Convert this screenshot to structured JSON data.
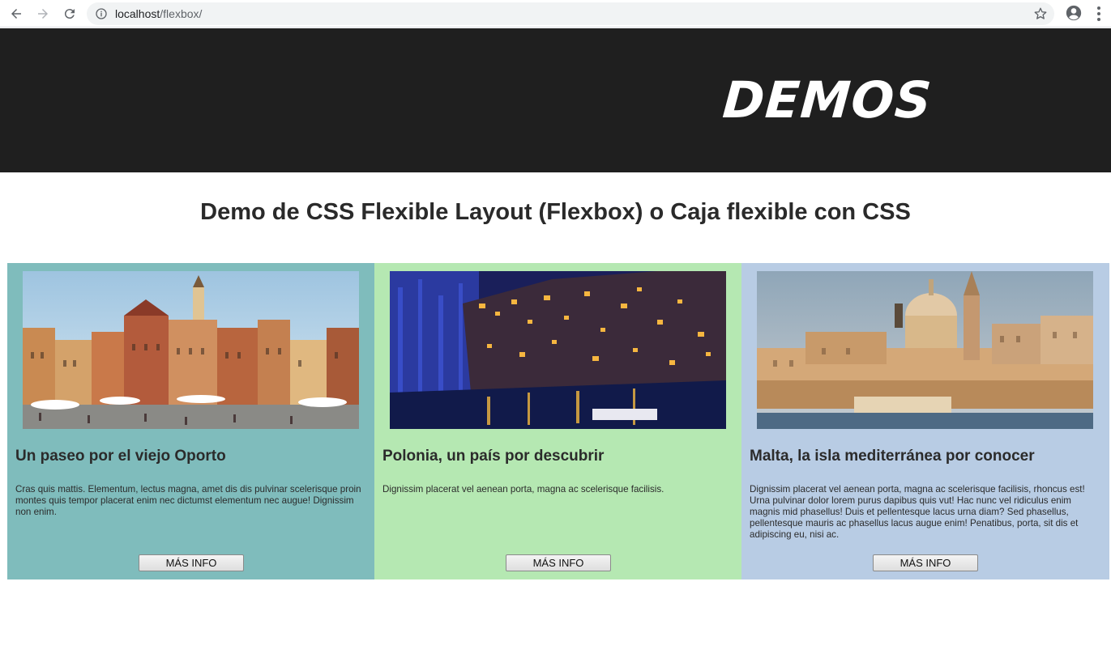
{
  "browser": {
    "url_host": "localhost",
    "url_path": "/flexbox/"
  },
  "header": {
    "logo_text": "DEMOS",
    "background": "#1f1f1f"
  },
  "main": {
    "title": "Demo de CSS Flexible Layout (Flexbox) o Caja flexible con CSS"
  },
  "cards": [
    {
      "title": "Un paseo por el viejo Oporto",
      "text": "Cras quis mattis. Elementum, lectus magna, amet dis dis pulvinar scelerisque proin montes quis tempor placerat enim nec dictumst elementum nec augue! Dignissim non enim.",
      "button": "MÁS INFO",
      "background": "#7fbcbc"
    },
    {
      "title": "Polonia, un país por descubrir",
      "text": "Dignissim placerat vel aenean porta, magna ac scelerisque facilisis.",
      "button": "MÁS INFO",
      "background": "#b5e8b2"
    },
    {
      "title": "Malta, la isla mediterránea por conocer",
      "text": "Dignissim placerat vel aenean porta, magna ac scelerisque facilisis, rhoncus est! Urna pulvinar dolor lorem purus dapibus quis vut! Hac nunc vel ridiculus enim magnis mid phasellus! Duis et pellentesque lacus urna diam? Sed phasellus, pellentesque mauris ac phasellus lacus augue enim! Penatibus, porta, sit dis et adipiscing eu, nisi ac.",
      "button": "MÁS INFO",
      "background": "#b8cce4"
    }
  ]
}
